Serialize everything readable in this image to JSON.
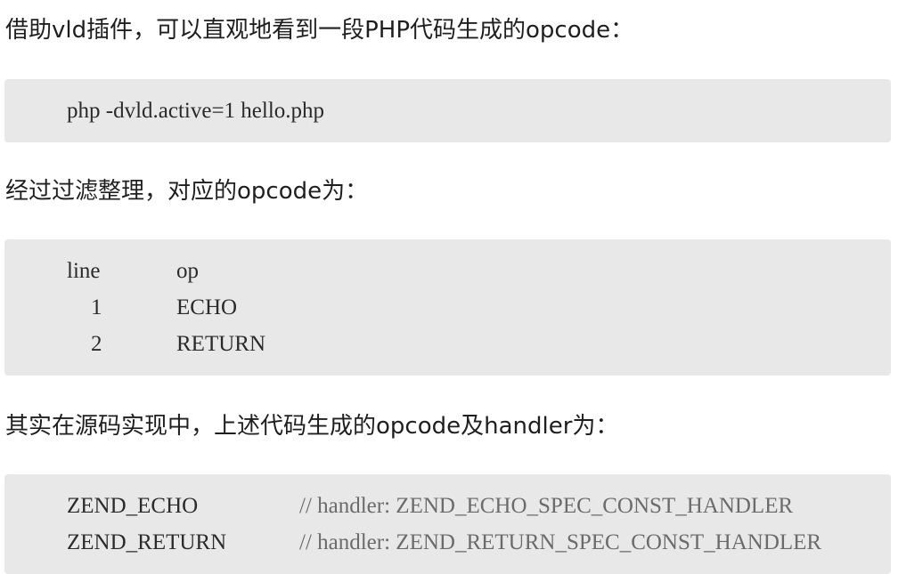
{
  "paragraphs": {
    "p1": "借助vld插件，可以直观地看到一段PHP代码生成的opcode：",
    "p2": "经过过滤整理，对应的opcode为：",
    "p3": "其实在源码实现中，上述代码生成的opcode及handler为："
  },
  "code1": {
    "line": "php -dvld.active=1 hello.php"
  },
  "code2": {
    "headers": [
      "line",
      "op"
    ],
    "rows": [
      {
        "line": "1",
        "op": "ECHO"
      },
      {
        "line": "2",
        "op": "RETURN"
      }
    ]
  },
  "code3": {
    "rows": [
      {
        "op": "ZEND_ECHO",
        "comment": "// handler: ZEND_ECHO_SPEC_CONST_HANDLER"
      },
      {
        "op": "ZEND_RETURN",
        "comment": "// handler: ZEND_RETURN_SPEC_CONST_HANDLER"
      }
    ]
  }
}
